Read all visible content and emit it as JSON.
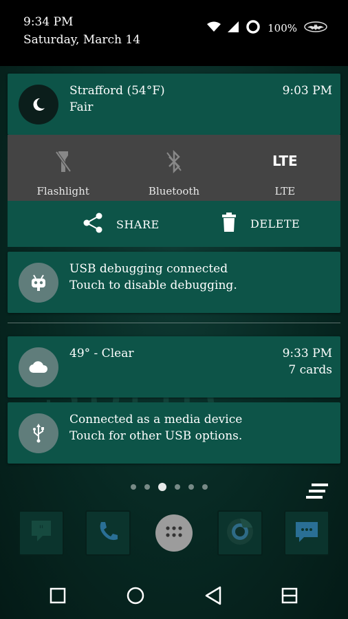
{
  "status_bar": {
    "time": "9:34 PM",
    "date": "Saturday, March 14",
    "battery_text": "100%",
    "icons": [
      "wifi-icon",
      "cell-signal-icon",
      "battery-ring-icon",
      "batman-icon"
    ]
  },
  "weather_notification": {
    "icon": "moon-icon",
    "title": "Strafford (54°F)",
    "subtitle": "Fair",
    "time": "9:03 PM"
  },
  "quick_settings": [
    {
      "label": "Flashlight",
      "icon": "flashlight-off-icon"
    },
    {
      "label": "Bluetooth",
      "icon": "bluetooth-off-icon"
    },
    {
      "label": "LTE",
      "icon": "lte-icon",
      "icon_text": "LTE"
    }
  ],
  "screenshot_actions": {
    "share_label": "SHARE",
    "delete_label": "DELETE"
  },
  "usb_debug_notification": {
    "icon": "android-head-icon",
    "title": "USB debugging connected",
    "subtitle": "Touch to disable debugging."
  },
  "clear_weather_notification": {
    "icon": "cloud-icon",
    "title": "49° - Clear",
    "time": "9:33 PM",
    "count": "7 cards"
  },
  "usb_media_notification": {
    "icon": "usb-icon",
    "title": "Connected as a media device",
    "subtitle": "Touch for other USB options."
  },
  "home_pager": {
    "pages": 6,
    "active_index": 2
  },
  "dock": [
    {
      "app": "hangouts",
      "icon": "hangouts-icon"
    },
    {
      "app": "phone",
      "icon": "phone-icon"
    },
    {
      "app": "app-drawer",
      "icon": "app-drawer-icon"
    },
    {
      "app": "chrome",
      "icon": "chrome-icon"
    },
    {
      "app": "messenger",
      "icon": "messenger-icon"
    }
  ],
  "navigation": [
    "recents-square-icon",
    "home-circle-icon",
    "back-triangle-icon",
    "multiwindow-icon"
  ],
  "colors": {
    "card": "#0d5448",
    "quick_settings": "#444444",
    "status_bar": "#000000"
  }
}
